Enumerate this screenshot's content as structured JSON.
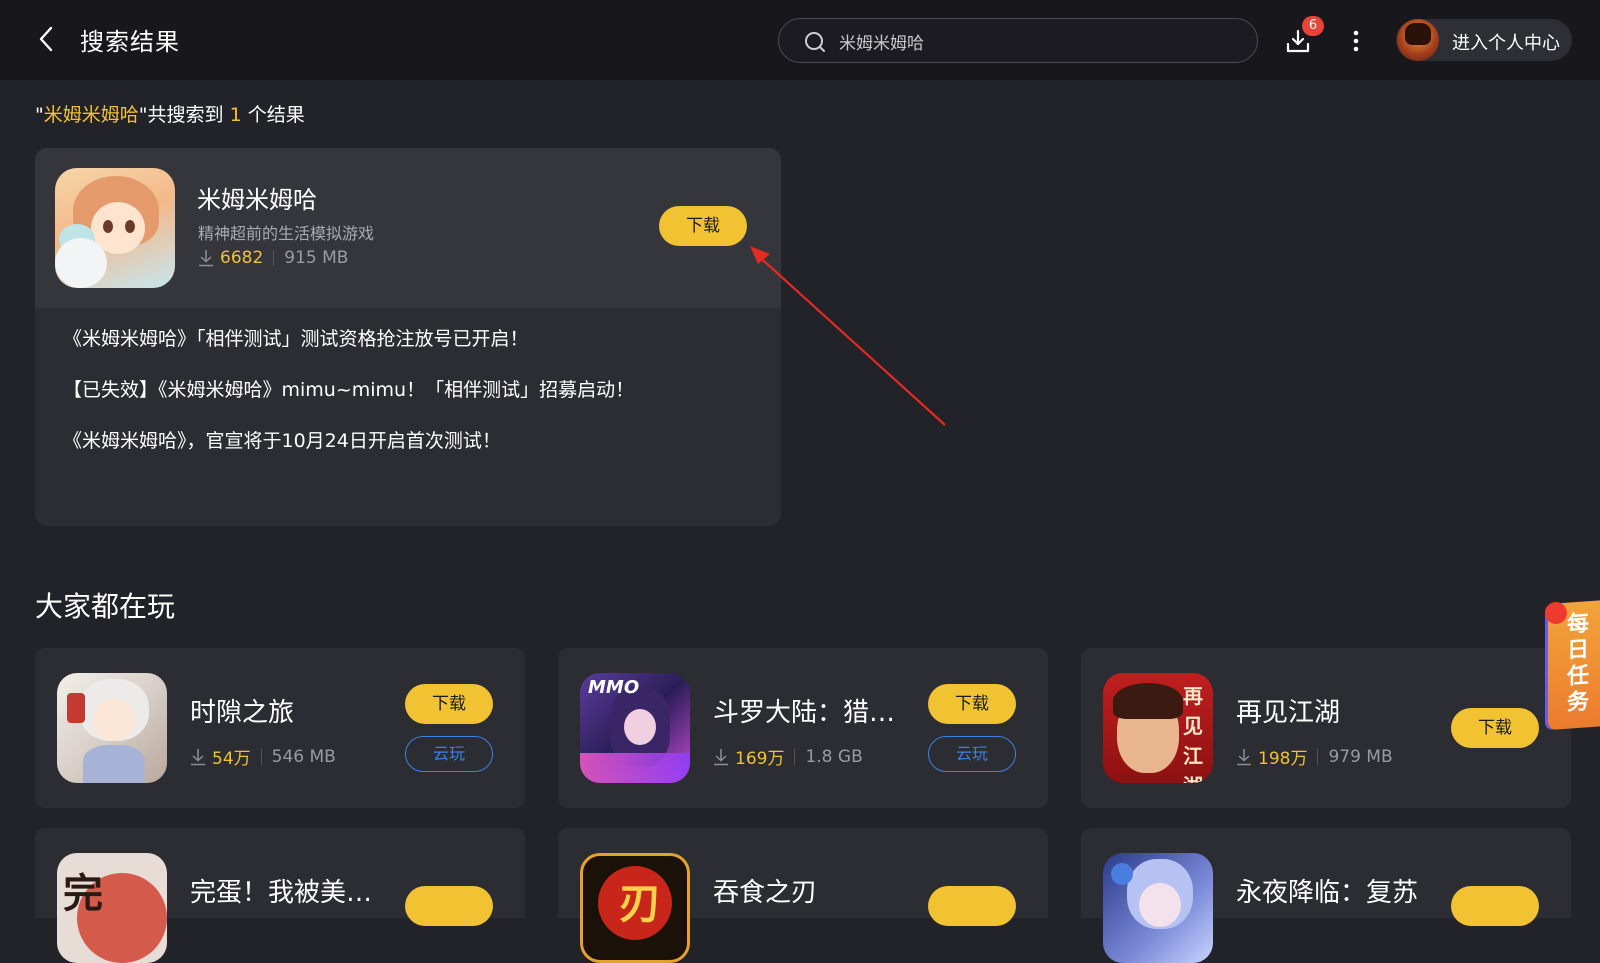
{
  "header": {
    "title": "搜索结果",
    "search_value": "米姆米姆哈",
    "download_badge": "6",
    "profile_label": "进入个人中心"
  },
  "summary": {
    "quote_open": "\"",
    "keyword": "米姆米姆哈",
    "quote_close": "\"",
    "middle": "共搜索到",
    "count": "1",
    "suffix": "个结果"
  },
  "result": {
    "name": "米姆米姆哈",
    "description": "精神超前的生活模拟游戏",
    "downloads": "6682",
    "size": "915 MB",
    "download_label": "下载",
    "news": [
      "《米姆米姆哈》「相伴测试」测试资格抢注放号已开启！",
      "【已失效】《米姆米姆哈》mimu~mimu！「相伴测试」招募启动！",
      "《米姆米姆哈》，官宣将于10月24日开启首次测试！"
    ]
  },
  "section": {
    "title": "大家都在玩",
    "games": [
      {
        "name": "时隙之旅",
        "downloads": "54万",
        "size": "546 MB",
        "download_label": "下载",
        "cloud_label": "云玩"
      },
      {
        "name": "斗罗大陆：猎…",
        "downloads": "169万",
        "size": "1.8 GB",
        "download_label": "下载",
        "cloud_label": "云玩",
        "icon_text": "MMO"
      },
      {
        "name": "再见江湖",
        "downloads": "198万",
        "size": "979 MB",
        "download_label": "下载",
        "icon_text": "再见江湖"
      },
      {
        "name": "完蛋！我被美…",
        "icon_text": "完"
      },
      {
        "name": "吞食之刃",
        "icon_text": "刃"
      },
      {
        "name": "永夜降临：复苏"
      }
    ]
  },
  "daily_task_label": "每日任务",
  "colors": {
    "accent_yellow": "#f1c232",
    "cloud_blue": "#3b82e4",
    "badge_red": "#e8443a",
    "background": "#222229"
  },
  "icons": [
    "back-arrow-icon",
    "search-icon",
    "download-icon",
    "more-vertical-icon",
    "download-count-icon"
  ]
}
